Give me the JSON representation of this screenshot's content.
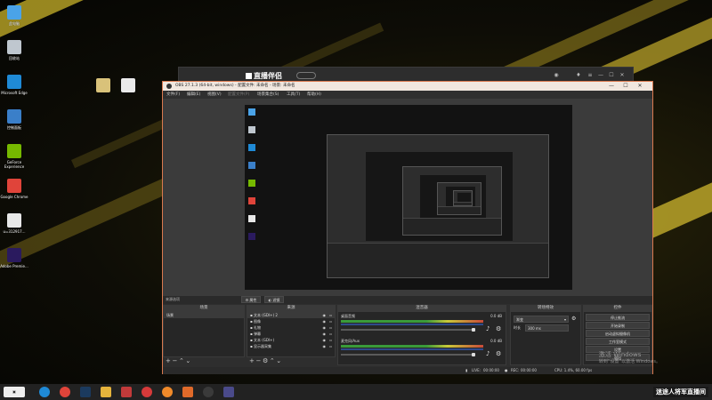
{
  "desktop": {
    "icons": [
      {
        "label": "此电脑",
        "icon": "computer-icon",
        "color": "#4aa3e8"
      },
      {
        "label": "回收站",
        "icon": "recycle-bin-icon",
        "color": "#bfc7cf"
      },
      {
        "label": "Microsoft Edge",
        "icon": "edge-icon",
        "color": "#1f8ad6"
      },
      {
        "label": "控制面板",
        "icon": "control-panel-icon",
        "color": "#3a7fc9"
      },
      {
        "label": "GeForce Experience",
        "icon": "geforce-icon",
        "color": "#76b900"
      },
      {
        "label": "Google Chrome",
        "icon": "chrome-icon",
        "color": "#e0443a"
      },
      {
        "label": "u=312917...",
        "icon": "image-file-icon",
        "color": "#e8e8e8"
      },
      {
        "label": "Adobe Premie...",
        "icon": "premiere-icon",
        "color": "#2a1a5e"
      }
    ],
    "files": [
      {
        "label": "",
        "icon": "file-icon",
        "color": "#d9c27a"
      },
      {
        "label": "",
        "icon": "document-icon",
        "color": "#eaeaea"
      }
    ]
  },
  "back_app": {
    "title": "直播伴侣",
    "badge": "",
    "window_buttons": [
      "—",
      "☐",
      "✕"
    ]
  },
  "obs": {
    "title": "OBS 27.1.3 (64-bit, windows) - 配置文件: 未命名 - 场景: 未命名",
    "menu": [
      "文件(F)",
      "编辑(E)",
      "视图(V)",
      "配置文件(P)",
      "场景集合(S)",
      "工具(T)",
      "帮助(H)"
    ],
    "stripbar_label": "来源选项",
    "docks": {
      "scenes": {
        "header": "场景",
        "items": [
          "场景"
        ]
      },
      "sources": {
        "header": "来源",
        "items": [
          {
            "label": "文本 (GDI+) 2",
            "icon": "text-icon"
          },
          {
            "label": "图像",
            "icon": "image-icon"
          },
          {
            "label": "礼物",
            "icon": "gift-icon"
          },
          {
            "label": "弹幕",
            "icon": "danmaku-icon"
          },
          {
            "label": "文本 (GDI+)",
            "icon": "text-icon"
          },
          {
            "label": "显示器采集",
            "icon": "monitor-icon"
          }
        ]
      },
      "mixer": {
        "header": "混音器",
        "channels": [
          {
            "name": "桌面音频",
            "db": "0.0 dB"
          },
          {
            "name": "麦克风/Aux",
            "db": "0.0 dB"
          }
        ]
      },
      "transitions": {
        "header": "转场特效",
        "type": "渐变",
        "duration_label": "时长",
        "duration": "300 ms"
      },
      "controls": {
        "header": "控件",
        "buttons": [
          "停止推流",
          "开始录制",
          "启动虚拟摄像机",
          "工作室模式",
          "设置",
          "退出"
        ]
      }
    },
    "status": {
      "live_label": "LIVE:",
      "live_time": "00:00:00",
      "rec_label": "REC:",
      "rec_time": "00:00:00",
      "cpu": "CPU: 1.4%, 60.00 fps"
    }
  },
  "watermark": {
    "line1": "激活 Windows",
    "line2": "转到“设置”以激活 Windows。"
  },
  "taskbar": {
    "icons": [
      {
        "icon": "edge-icon",
        "color": "#1f8ad6"
      },
      {
        "icon": "chrome-icon",
        "color": "#e0443a"
      },
      {
        "icon": "steam-icon",
        "color": "#1b3a5e"
      },
      {
        "icon": "folder-icon",
        "color": "#e6b43c"
      },
      {
        "icon": "app-icon",
        "color": "#c23a3a"
      },
      {
        "icon": "netease-music-icon",
        "color": "#d63a3a"
      },
      {
        "icon": "orange-app-icon",
        "color": "#f08a2a"
      },
      {
        "icon": "game-icon",
        "color": "#e06a2a"
      },
      {
        "icon": "obs-icon",
        "color": "#3a3a3a"
      },
      {
        "icon": "live-app-icon",
        "color": "#4a4a8a"
      }
    ],
    "brand": "迷途人将军直播间"
  }
}
